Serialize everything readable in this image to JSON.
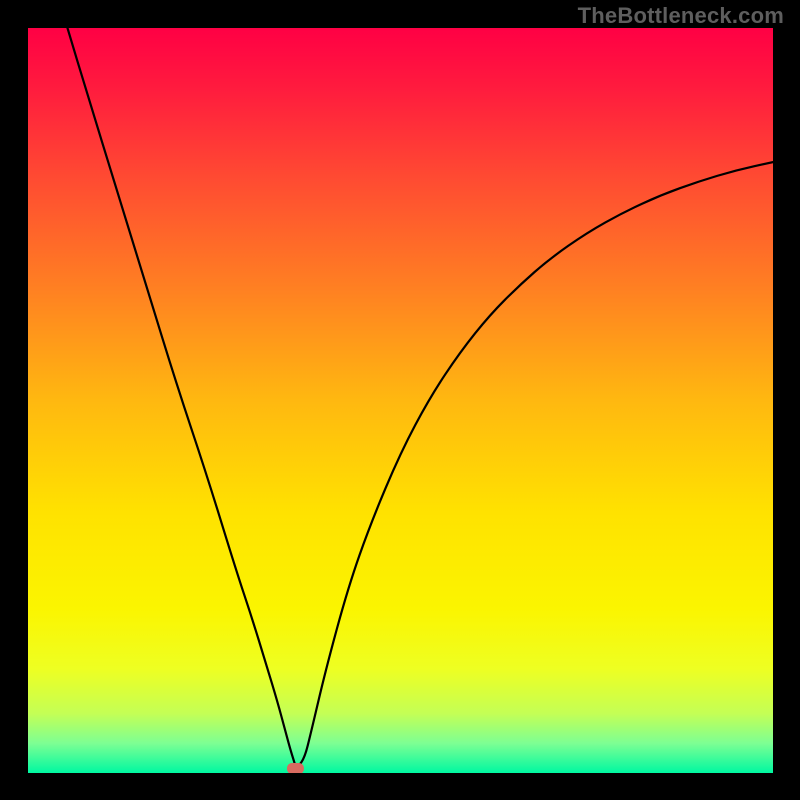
{
  "watermark": "TheBottleneck.com",
  "chart_data": {
    "type": "line",
    "title": "",
    "xlabel": "",
    "ylabel": "",
    "xlim": [
      0,
      100
    ],
    "ylim": [
      0,
      100
    ],
    "grid": false,
    "legend": false,
    "background_gradient": {
      "orientation": "vertical",
      "stops": [
        {
          "t": 0.0,
          "color": "#ff0044"
        },
        {
          "t": 0.08,
          "color": "#ff1b3e"
        },
        {
          "t": 0.2,
          "color": "#ff4a32"
        },
        {
          "t": 0.35,
          "color": "#ff8022"
        },
        {
          "t": 0.5,
          "color": "#ffb810"
        },
        {
          "t": 0.65,
          "color": "#ffe200"
        },
        {
          "t": 0.78,
          "color": "#fbf500"
        },
        {
          "t": 0.86,
          "color": "#eeff22"
        },
        {
          "t": 0.92,
          "color": "#c4ff55"
        },
        {
          "t": 0.96,
          "color": "#7dff93"
        },
        {
          "t": 1.0,
          "color": "#00f8a1"
        }
      ]
    },
    "series": [
      {
        "name": "bottleneck-curve",
        "x": [
          5.3,
          8.0,
          12.0,
          16.0,
          20.0,
          24.0,
          28.0,
          30.0,
          32.0,
          33.5,
          34.5,
          35.2,
          35.7,
          36.0,
          37.1,
          38.0,
          40.0,
          43.0,
          46.0,
          50.0,
          54.0,
          58.0,
          62.0,
          66.0,
          70.0,
          75.0,
          80.0,
          85.0,
          90.0,
          95.0,
          100.0
        ],
        "y": [
          100.0,
          91.0,
          78.0,
          65.0,
          52.0,
          40.0,
          27.0,
          21.0,
          14.5,
          9.5,
          5.8,
          3.2,
          1.6,
          0.6,
          1.9,
          5.5,
          14.0,
          25.0,
          33.5,
          43.0,
          50.5,
          56.5,
          61.5,
          65.5,
          69.0,
          72.5,
          75.3,
          77.6,
          79.4,
          80.9,
          82.0
        ]
      }
    ],
    "marker": {
      "name": "optimal-point",
      "x": 35.9,
      "y": 0.6,
      "color": "#d86b60",
      "shape": "capsule"
    }
  }
}
